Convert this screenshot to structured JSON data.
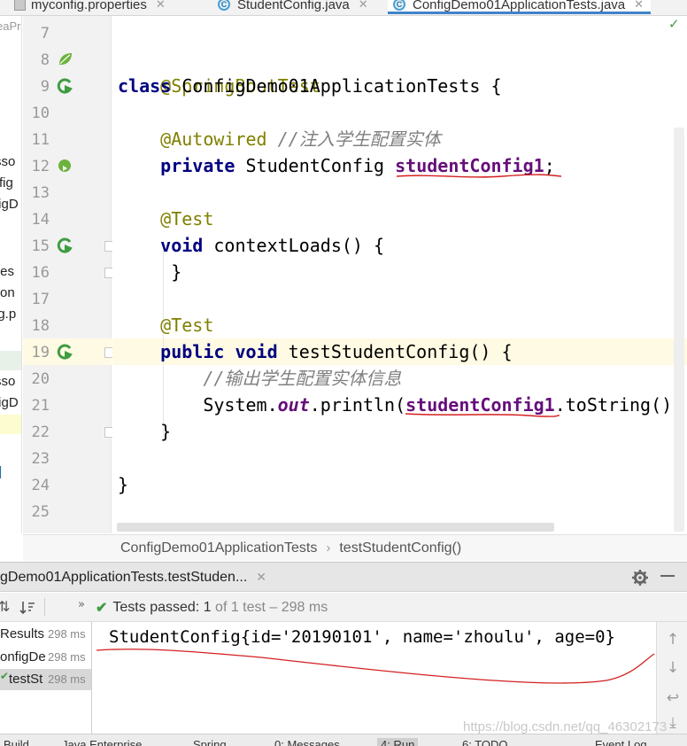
{
  "tabs": [
    {
      "label": "myconfig.properties",
      "icon": "properties-file-icon",
      "active": false
    },
    {
      "label": "StudentConfig.java",
      "icon": "java-class-icon",
      "active": false
    },
    {
      "label": "ConfigDemo01ApplicationTests.java",
      "icon": "java-class-icon",
      "active": true
    }
  ],
  "project_tree_clipped": [
    "eaPr",
    "sso",
    "fig",
    "figD",
    "tes",
    "ction",
    "ig.p",
    "sso",
    "figD"
  ],
  "editor": {
    "line_numbers": [
      "7",
      "8",
      "9",
      "10",
      "11",
      "12",
      "13",
      "14",
      "15",
      "16",
      "17",
      "18",
      "19",
      "20",
      "21",
      "22",
      "23",
      "24",
      "25"
    ],
    "highlighted_line": "19",
    "lines": {
      "l8": {
        "annotation": "@SpringBootTest"
      },
      "l9": {
        "keyword": "class",
        "name": "ConfigDemo01ApplicationTests {"
      },
      "l11": {
        "annotation": "@Autowired",
        "comment": "//注入学生配置实体"
      },
      "l12": {
        "keyword": "private",
        "type": "StudentConfig",
        "field": "studentConfig1",
        "end": ";"
      },
      "l14": {
        "annotation": "@Test"
      },
      "l15": {
        "keyword": "void",
        "rest": "contextLoads() {"
      },
      "l16": {
        "text": "}"
      },
      "l18": {
        "annotation": "@Test"
      },
      "l19": {
        "keyword": "public void",
        "rest": "testStudentConfig() {"
      },
      "l20": {
        "comment": "//输出学生配置实体信息"
      },
      "l21": {
        "prefix": "System.",
        "static_field": "out",
        "mid": ".println(",
        "field": "studentConfig1",
        "rest": ".toString())"
      },
      "l22": {
        "text": "}"
      },
      "l24": {
        "text": "}"
      }
    }
  },
  "breadcrumb": {
    "class_name": "ConfigDemo01ApplicationTests",
    "method_name": "testStudentConfig()",
    "separator": "›"
  },
  "run_panel": {
    "tab_label": "gDemo01ApplicationTests.testStuden...",
    "status_prefix": "Tests passed:",
    "status_count": "1",
    "status_suffix": "of 1 test – 298 ms",
    "tree": [
      {
        "name": "Results",
        "time": "298 ms"
      },
      {
        "name": "onfigDe",
        "time": "298 ms"
      },
      {
        "name": "testSt",
        "time": "298 ms"
      }
    ],
    "console_output": "StudentConfig{id='20190101', name='zhoulu', age=0}"
  },
  "watermark": "https://blog.csdn.net/qq_46302173",
  "bottom_bar": [
    "Build",
    "Java Enterprise",
    "Spring",
    "0: Messages",
    "4: Run",
    "6: TODO",
    "Event Log"
  ],
  "colors": {
    "keyword": "#000080",
    "annotation": "#808000",
    "comment": "#808080",
    "field": "#660e7a",
    "current_line": "#fffae3",
    "pass_green": "#3e9c42",
    "squiggle_red": "#d32020"
  }
}
